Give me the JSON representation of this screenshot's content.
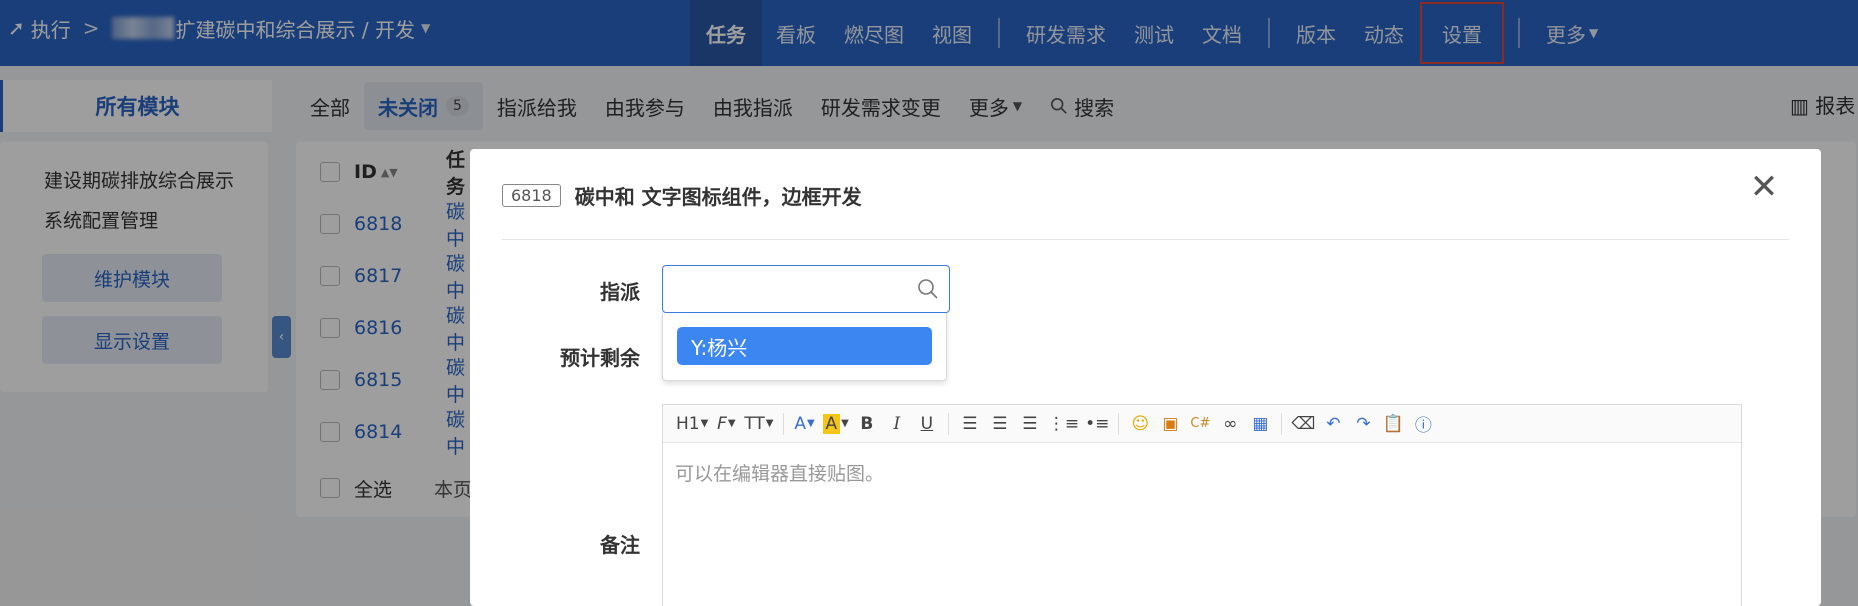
{
  "topnav": {
    "section": "执行",
    "project": "扩建碳中和综合展示 / 开发",
    "items": [
      {
        "label": "任务"
      },
      {
        "label": "看板"
      },
      {
        "label": "燃尽图"
      },
      {
        "label": "视图"
      },
      {
        "label": "研发需求"
      },
      {
        "label": "测试"
      },
      {
        "label": "文档"
      },
      {
        "label": "版本"
      },
      {
        "label": "动态"
      },
      {
        "label": "设置"
      },
      {
        "label": "更多"
      }
    ]
  },
  "subnav": {
    "module_title": "所有模块",
    "filters": [
      {
        "label": "全部"
      },
      {
        "label": "未关闭",
        "count": "5"
      },
      {
        "label": "指派给我"
      },
      {
        "label": "由我参与"
      },
      {
        "label": "由我指派"
      },
      {
        "label": "研发需求变更"
      },
      {
        "label": "更多"
      }
    ],
    "search_label": "搜索",
    "report_label": "报表"
  },
  "sidebar": {
    "modules": [
      "建设期碳排放综合展示",
      "系统配置管理"
    ],
    "maintain_button": "维护模块",
    "display_button": "显示设置"
  },
  "table": {
    "header_id": "ID",
    "header_task": "任务",
    "rows": [
      {
        "id": "6818",
        "task": "碳中"
      },
      {
        "id": "6817",
        "task": "碳中"
      },
      {
        "id": "6816",
        "task": "碳中"
      },
      {
        "id": "6815",
        "task": "碳中"
      },
      {
        "id": "6814",
        "task": "碳中"
      }
    ],
    "select_all": "全选",
    "page_info": "本页"
  },
  "modal": {
    "task_id": "6818",
    "title": "碳中和 文字图标组件，边框开发",
    "close_symbol": "✕",
    "fields": {
      "assign_label": "指派",
      "assign_value": "",
      "estimate_label": "预计剩余",
      "note_label": "备注"
    },
    "dropdown_options": [
      "Y:杨兴"
    ],
    "editor": {
      "placeholder": "可以在编辑器直接贴图。",
      "toolbar": [
        "H1",
        "F",
        "TT",
        "A",
        "A",
        "B",
        "I",
        "U"
      ]
    }
  },
  "colors": {
    "nav_bg": "#2b65c4",
    "accent": "#3b86f0",
    "highlight_box": "#e3453a"
  }
}
